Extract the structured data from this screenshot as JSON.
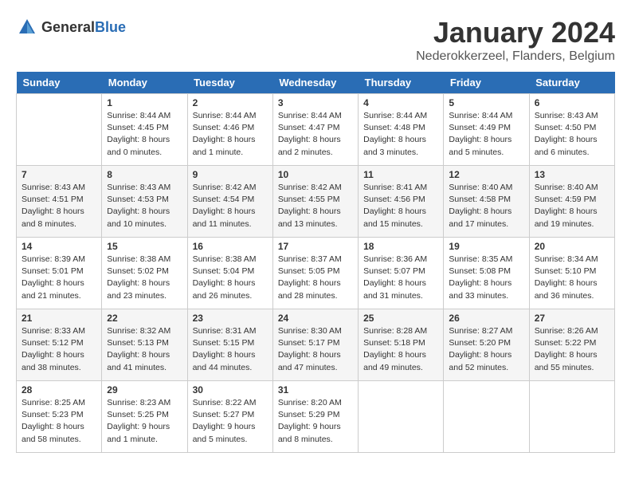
{
  "logo": {
    "general": "General",
    "blue": "Blue"
  },
  "title": {
    "month": "January 2024",
    "location": "Nederokkerzeel, Flanders, Belgium"
  },
  "weekdays": [
    "Sunday",
    "Monday",
    "Tuesday",
    "Wednesday",
    "Thursday",
    "Friday",
    "Saturday"
  ],
  "weeks": [
    [
      {
        "day": "",
        "sunrise": "",
        "sunset": "",
        "daylight": ""
      },
      {
        "day": "1",
        "sunrise": "Sunrise: 8:44 AM",
        "sunset": "Sunset: 4:45 PM",
        "daylight": "Daylight: 8 hours and 0 minutes."
      },
      {
        "day": "2",
        "sunrise": "Sunrise: 8:44 AM",
        "sunset": "Sunset: 4:46 PM",
        "daylight": "Daylight: 8 hours and 1 minute."
      },
      {
        "day": "3",
        "sunrise": "Sunrise: 8:44 AM",
        "sunset": "Sunset: 4:47 PM",
        "daylight": "Daylight: 8 hours and 2 minutes."
      },
      {
        "day": "4",
        "sunrise": "Sunrise: 8:44 AM",
        "sunset": "Sunset: 4:48 PM",
        "daylight": "Daylight: 8 hours and 3 minutes."
      },
      {
        "day": "5",
        "sunrise": "Sunrise: 8:44 AM",
        "sunset": "Sunset: 4:49 PM",
        "daylight": "Daylight: 8 hours and 5 minutes."
      },
      {
        "day": "6",
        "sunrise": "Sunrise: 8:43 AM",
        "sunset": "Sunset: 4:50 PM",
        "daylight": "Daylight: 8 hours and 6 minutes."
      }
    ],
    [
      {
        "day": "7",
        "sunrise": "Sunrise: 8:43 AM",
        "sunset": "Sunset: 4:51 PM",
        "daylight": "Daylight: 8 hours and 8 minutes."
      },
      {
        "day": "8",
        "sunrise": "Sunrise: 8:43 AM",
        "sunset": "Sunset: 4:53 PM",
        "daylight": "Daylight: 8 hours and 10 minutes."
      },
      {
        "day": "9",
        "sunrise": "Sunrise: 8:42 AM",
        "sunset": "Sunset: 4:54 PM",
        "daylight": "Daylight: 8 hours and 11 minutes."
      },
      {
        "day": "10",
        "sunrise": "Sunrise: 8:42 AM",
        "sunset": "Sunset: 4:55 PM",
        "daylight": "Daylight: 8 hours and 13 minutes."
      },
      {
        "day": "11",
        "sunrise": "Sunrise: 8:41 AM",
        "sunset": "Sunset: 4:56 PM",
        "daylight": "Daylight: 8 hours and 15 minutes."
      },
      {
        "day": "12",
        "sunrise": "Sunrise: 8:40 AM",
        "sunset": "Sunset: 4:58 PM",
        "daylight": "Daylight: 8 hours and 17 minutes."
      },
      {
        "day": "13",
        "sunrise": "Sunrise: 8:40 AM",
        "sunset": "Sunset: 4:59 PM",
        "daylight": "Daylight: 8 hours and 19 minutes."
      }
    ],
    [
      {
        "day": "14",
        "sunrise": "Sunrise: 8:39 AM",
        "sunset": "Sunset: 5:01 PM",
        "daylight": "Daylight: 8 hours and 21 minutes."
      },
      {
        "day": "15",
        "sunrise": "Sunrise: 8:38 AM",
        "sunset": "Sunset: 5:02 PM",
        "daylight": "Daylight: 8 hours and 23 minutes."
      },
      {
        "day": "16",
        "sunrise": "Sunrise: 8:38 AM",
        "sunset": "Sunset: 5:04 PM",
        "daylight": "Daylight: 8 hours and 26 minutes."
      },
      {
        "day": "17",
        "sunrise": "Sunrise: 8:37 AM",
        "sunset": "Sunset: 5:05 PM",
        "daylight": "Daylight: 8 hours and 28 minutes."
      },
      {
        "day": "18",
        "sunrise": "Sunrise: 8:36 AM",
        "sunset": "Sunset: 5:07 PM",
        "daylight": "Daylight: 8 hours and 31 minutes."
      },
      {
        "day": "19",
        "sunrise": "Sunrise: 8:35 AM",
        "sunset": "Sunset: 5:08 PM",
        "daylight": "Daylight: 8 hours and 33 minutes."
      },
      {
        "day": "20",
        "sunrise": "Sunrise: 8:34 AM",
        "sunset": "Sunset: 5:10 PM",
        "daylight": "Daylight: 8 hours and 36 minutes."
      }
    ],
    [
      {
        "day": "21",
        "sunrise": "Sunrise: 8:33 AM",
        "sunset": "Sunset: 5:12 PM",
        "daylight": "Daylight: 8 hours and 38 minutes."
      },
      {
        "day": "22",
        "sunrise": "Sunrise: 8:32 AM",
        "sunset": "Sunset: 5:13 PM",
        "daylight": "Daylight: 8 hours and 41 minutes."
      },
      {
        "day": "23",
        "sunrise": "Sunrise: 8:31 AM",
        "sunset": "Sunset: 5:15 PM",
        "daylight": "Daylight: 8 hours and 44 minutes."
      },
      {
        "day": "24",
        "sunrise": "Sunrise: 8:30 AM",
        "sunset": "Sunset: 5:17 PM",
        "daylight": "Daylight: 8 hours and 47 minutes."
      },
      {
        "day": "25",
        "sunrise": "Sunrise: 8:28 AM",
        "sunset": "Sunset: 5:18 PM",
        "daylight": "Daylight: 8 hours and 49 minutes."
      },
      {
        "day": "26",
        "sunrise": "Sunrise: 8:27 AM",
        "sunset": "Sunset: 5:20 PM",
        "daylight": "Daylight: 8 hours and 52 minutes."
      },
      {
        "day": "27",
        "sunrise": "Sunrise: 8:26 AM",
        "sunset": "Sunset: 5:22 PM",
        "daylight": "Daylight: 8 hours and 55 minutes."
      }
    ],
    [
      {
        "day": "28",
        "sunrise": "Sunrise: 8:25 AM",
        "sunset": "Sunset: 5:23 PM",
        "daylight": "Daylight: 8 hours and 58 minutes."
      },
      {
        "day": "29",
        "sunrise": "Sunrise: 8:23 AM",
        "sunset": "Sunset: 5:25 PM",
        "daylight": "Daylight: 9 hours and 1 minute."
      },
      {
        "day": "30",
        "sunrise": "Sunrise: 8:22 AM",
        "sunset": "Sunset: 5:27 PM",
        "daylight": "Daylight: 9 hours and 5 minutes."
      },
      {
        "day": "31",
        "sunrise": "Sunrise: 8:20 AM",
        "sunset": "Sunset: 5:29 PM",
        "daylight": "Daylight: 9 hours and 8 minutes."
      },
      {
        "day": "",
        "sunrise": "",
        "sunset": "",
        "daylight": ""
      },
      {
        "day": "",
        "sunrise": "",
        "sunset": "",
        "daylight": ""
      },
      {
        "day": "",
        "sunrise": "",
        "sunset": "",
        "daylight": ""
      }
    ]
  ]
}
